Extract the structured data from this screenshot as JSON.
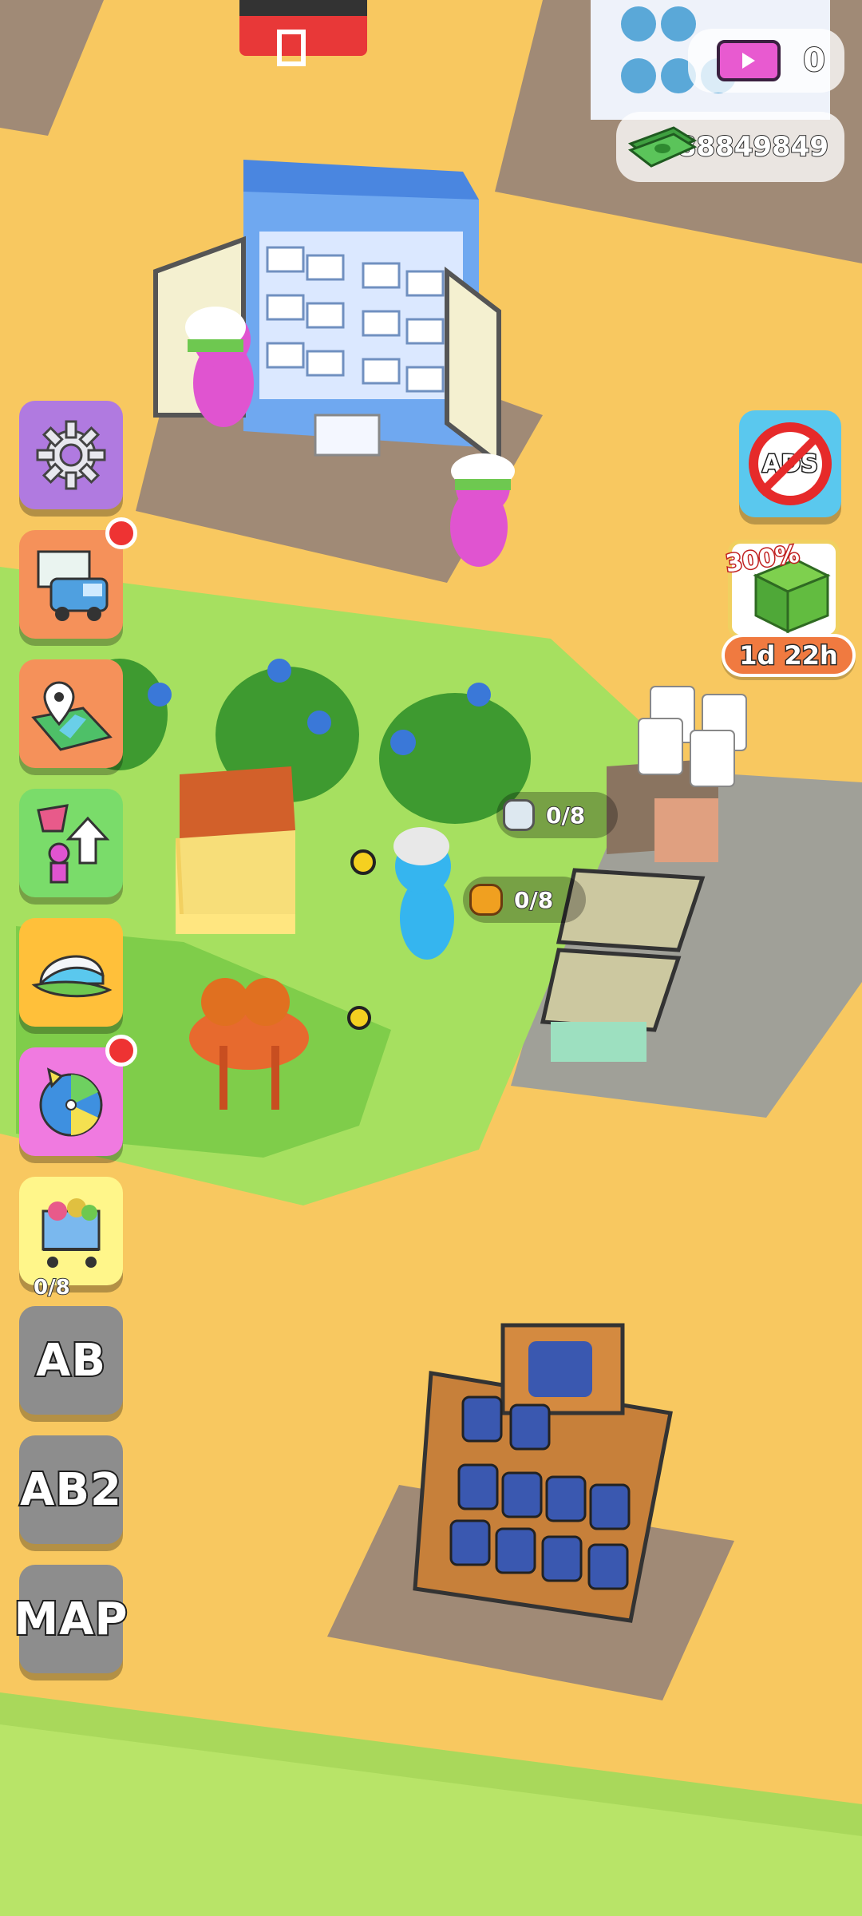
{
  "hud": {
    "tickets": "0",
    "money": "88849849",
    "ads_label": "ADS",
    "boost_percent": "300%",
    "boost_timer": "1d 22h"
  },
  "sidebar": {
    "ab_label": "AB",
    "ab2_label": "AB2",
    "map_label": "MAP"
  },
  "stations": {
    "fridge_counter": "0/8",
    "honey_counter": "0/8",
    "left_edge_counter": "0/8"
  },
  "colors": {
    "ground": "#f8c860",
    "grass": "#a6e060",
    "gear_button": "#b07ae0",
    "truck_button": "#f5915a",
    "map_button": "#f5915a",
    "upgrade_button": "#7adc6a",
    "cap_button": "#ffc03a",
    "spin_button": "#f07ae0",
    "cart_button": "#fff68a",
    "ads_button": "#5ac8ee",
    "badge_red": "#ee3333"
  }
}
